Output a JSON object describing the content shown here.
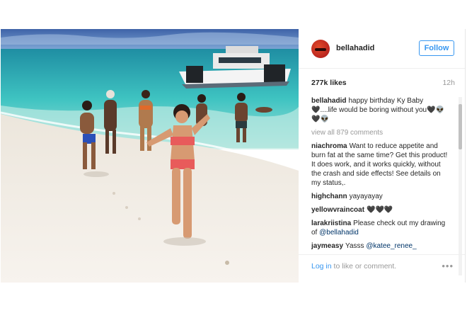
{
  "post": {
    "username": "bellahadid",
    "follow_label": "Follow",
    "likes": "277k likes",
    "time": "12h",
    "caption_user": "bellahadid",
    "caption_text": "happy birthday Ky Baby 🖤....life would be boring without you🖤👽🖤👽",
    "view_all": "view all 879 comments",
    "comments": [
      {
        "user": "niachroma",
        "text": "Want to reduce appetite and burn fat at the same time? Get this product! It does work, and it works quickly, without the crash and side effects! See details on my status,."
      },
      {
        "user": "highchann",
        "text": "yayayayay"
      },
      {
        "user": "yellowvraincoat",
        "text": "🖤🖤🖤"
      },
      {
        "user": "larakriistina",
        "text": "Please check out my drawing of ",
        "mention": "@bellahadid"
      },
      {
        "user": "jaymeasy",
        "text": "Yasss ",
        "mention": "@katee_renee_"
      }
    ],
    "login_link": "Log in",
    "login_rest": " to like or comment.",
    "more_icon": "•••"
  },
  "colors": {
    "accent": "#3897f0",
    "text": "#262626",
    "muted": "#999999"
  }
}
